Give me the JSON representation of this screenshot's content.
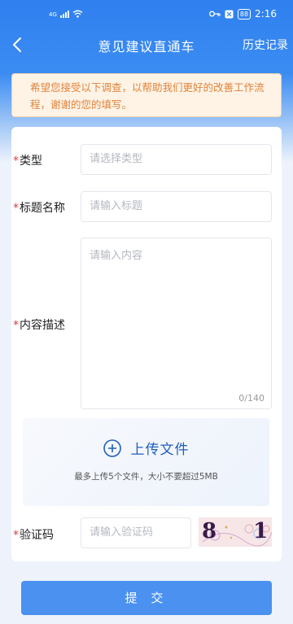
{
  "status_bar": {
    "signal": "4G",
    "battery": "88",
    "time": "2:16"
  },
  "nav": {
    "title": "意见建议直通车",
    "history_label": "历史记录"
  },
  "notice": {
    "text": "希望您接受以下调查，以帮助我们更好的改善工作流程，谢谢的您的填写。"
  },
  "form": {
    "type": {
      "label": "类型",
      "placeholder": "请选择类型"
    },
    "title": {
      "label": "标题名称",
      "placeholder": "请输入标题"
    },
    "content": {
      "label": "内容描述",
      "placeholder": "请输入内容",
      "counter": "0/140"
    },
    "upload": {
      "label": "上传文件",
      "hint": "最多上传5个文件，大小不要超过5MB"
    },
    "captcha": {
      "label": "验证码",
      "placeholder": "请输入验证码",
      "code_text": "8 1"
    }
  },
  "submit_label": "提 交",
  "colors": {
    "primary": "#4a91f0",
    "required": "#e23a3a",
    "notice_text": "#e0833a"
  }
}
